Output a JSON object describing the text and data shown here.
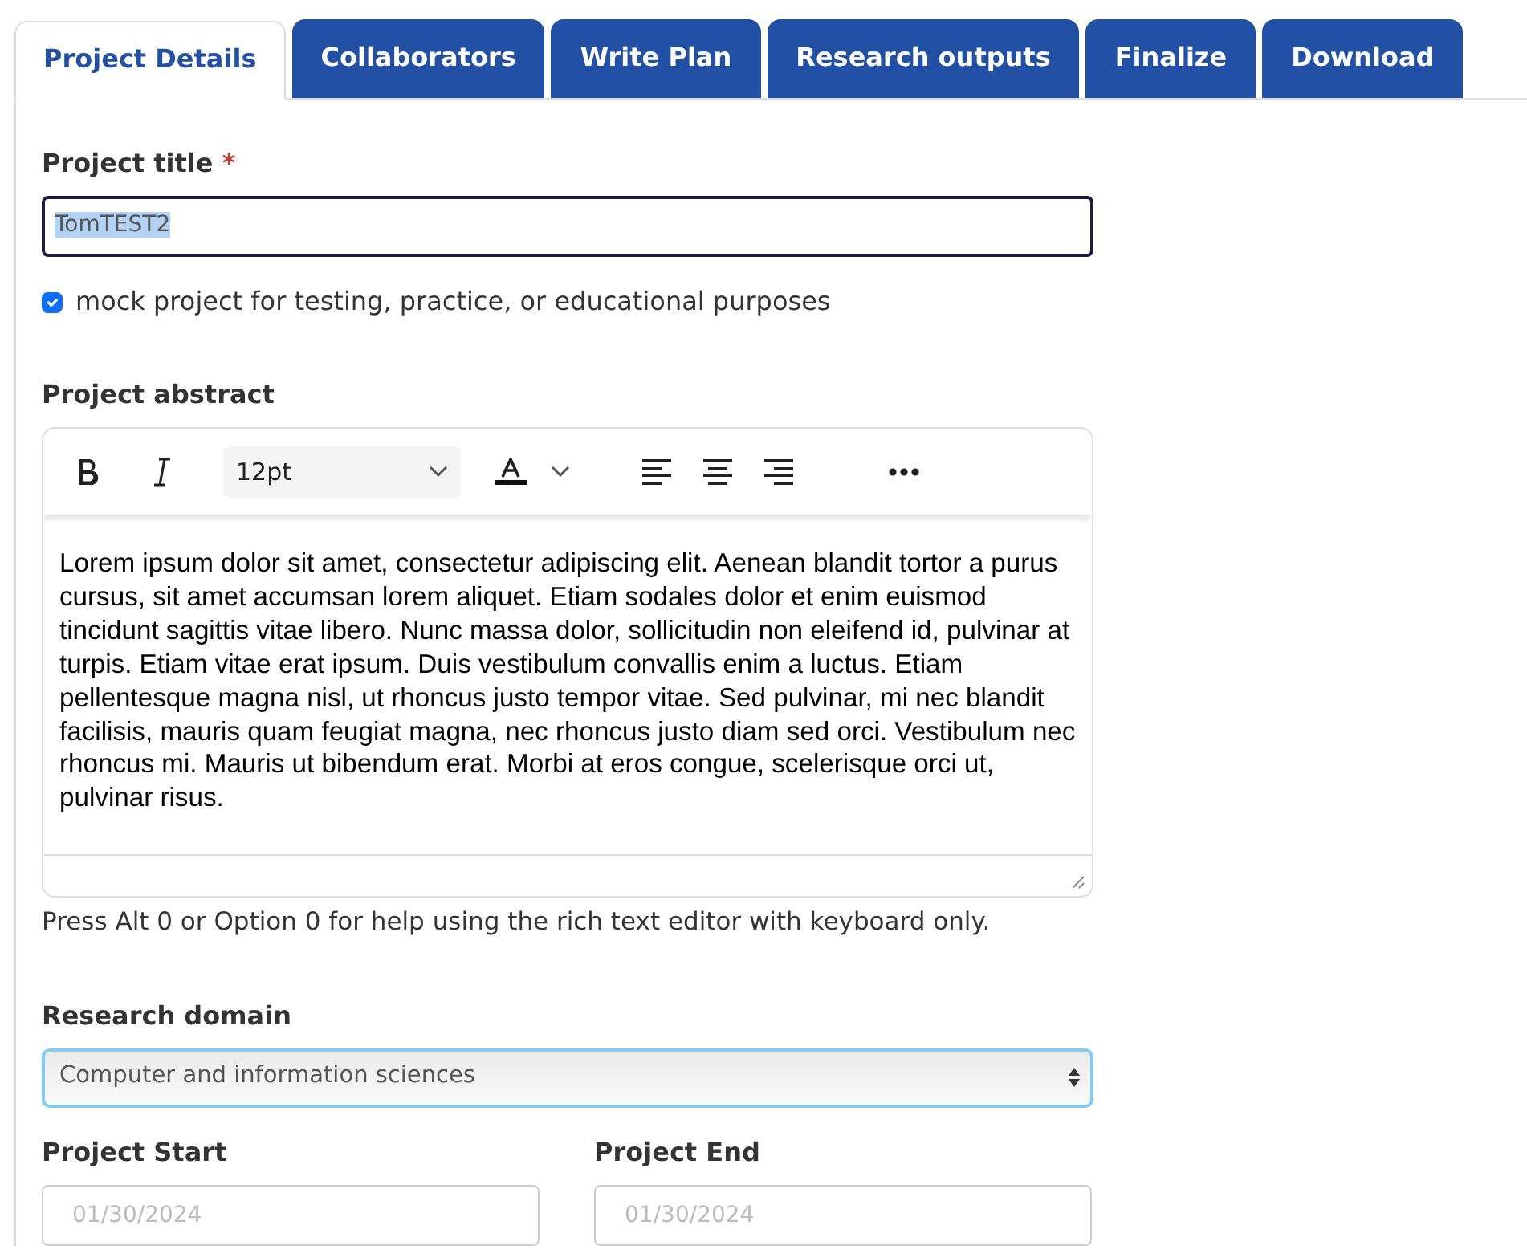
{
  "tabs": [
    {
      "label": "Project Details",
      "selected": true
    },
    {
      "label": "Collaborators",
      "selected": false
    },
    {
      "label": "Write Plan",
      "selected": false
    },
    {
      "label": "Research outputs",
      "selected": false
    },
    {
      "label": "Finalize",
      "selected": false
    },
    {
      "label": "Download",
      "selected": false
    }
  ],
  "title_field": {
    "label": "Project title",
    "required_mark": "*",
    "value": "TomTEST2",
    "highlighted": true
  },
  "mock_checkbox": {
    "label": "mock project for testing, practice, or educational purposes",
    "checked": true
  },
  "abstract": {
    "label": "Project abstract",
    "font_size": "12pt",
    "text": "Lorem ipsum dolor sit amet, consectetur adipiscing elit. Aenean blandit tortor a purus cursus, sit amet accumsan lorem aliquet. Etiam sodales dolor et enim euismod tincidunt sagittis vitae libero. Nunc massa dolor, sollicitudin non eleifend id, pulvinar at turpis. Etiam vitae erat ipsum. Duis vestibulum convallis enim a luctus. Etiam pellentesque magna nisl, ut rhoncus justo tempor vitae. Sed pulvinar, mi nec blandit facilisis, mauris quam feugiat magna, nec rhoncus justo diam sed orci. Vestibulum nec rhoncus mi. Mauris ut bibendum erat. Morbi at eros congue, scelerisque orci ut, pulvinar risus.",
    "help": "Press Alt 0 or Option 0 for help using the rich text editor with keyboard only."
  },
  "research_domain": {
    "label": "Research domain",
    "value": "Computer and information sciences"
  },
  "dates": [
    {
      "label": "Project Start",
      "placeholder": "01/30/2024"
    },
    {
      "label": "Project End",
      "placeholder": "01/30/2024"
    }
  ]
}
